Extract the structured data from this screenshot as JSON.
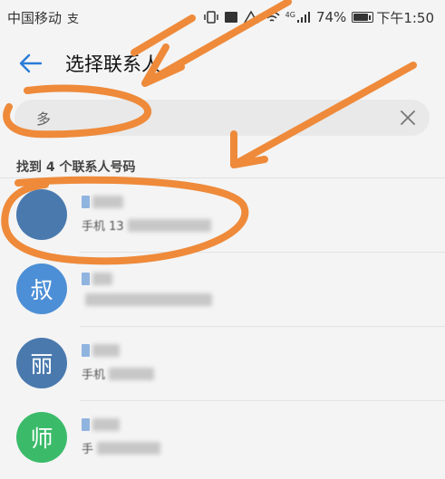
{
  "status_bar": {
    "carrier": "中国移动",
    "carrier_icon_char": "支",
    "battery_percent": "74%",
    "time": "下午1:50",
    "network": "4G"
  },
  "header": {
    "back_icon": "arrow-left-icon",
    "title": "选择联系人"
  },
  "search": {
    "value": "多",
    "clear_icon": "close-icon"
  },
  "results": {
    "count_label": "找到 4 个联系人号码"
  },
  "contacts": [
    {
      "avatar_char": "",
      "avatar_color": "#4a79ae",
      "phone_label": "手机 13"
    },
    {
      "avatar_char": "叔",
      "avatar_color": "#4d8fd6",
      "phone_label": ""
    },
    {
      "avatar_char": "丽",
      "avatar_color": "#4a79ae",
      "phone_label": "手机"
    },
    {
      "avatar_char": "师",
      "avatar_color": "#3bbb6a",
      "phone_label": "手"
    }
  ],
  "colors": {
    "accent": "#2a7cd8",
    "annotation": "#ee8a3a"
  }
}
